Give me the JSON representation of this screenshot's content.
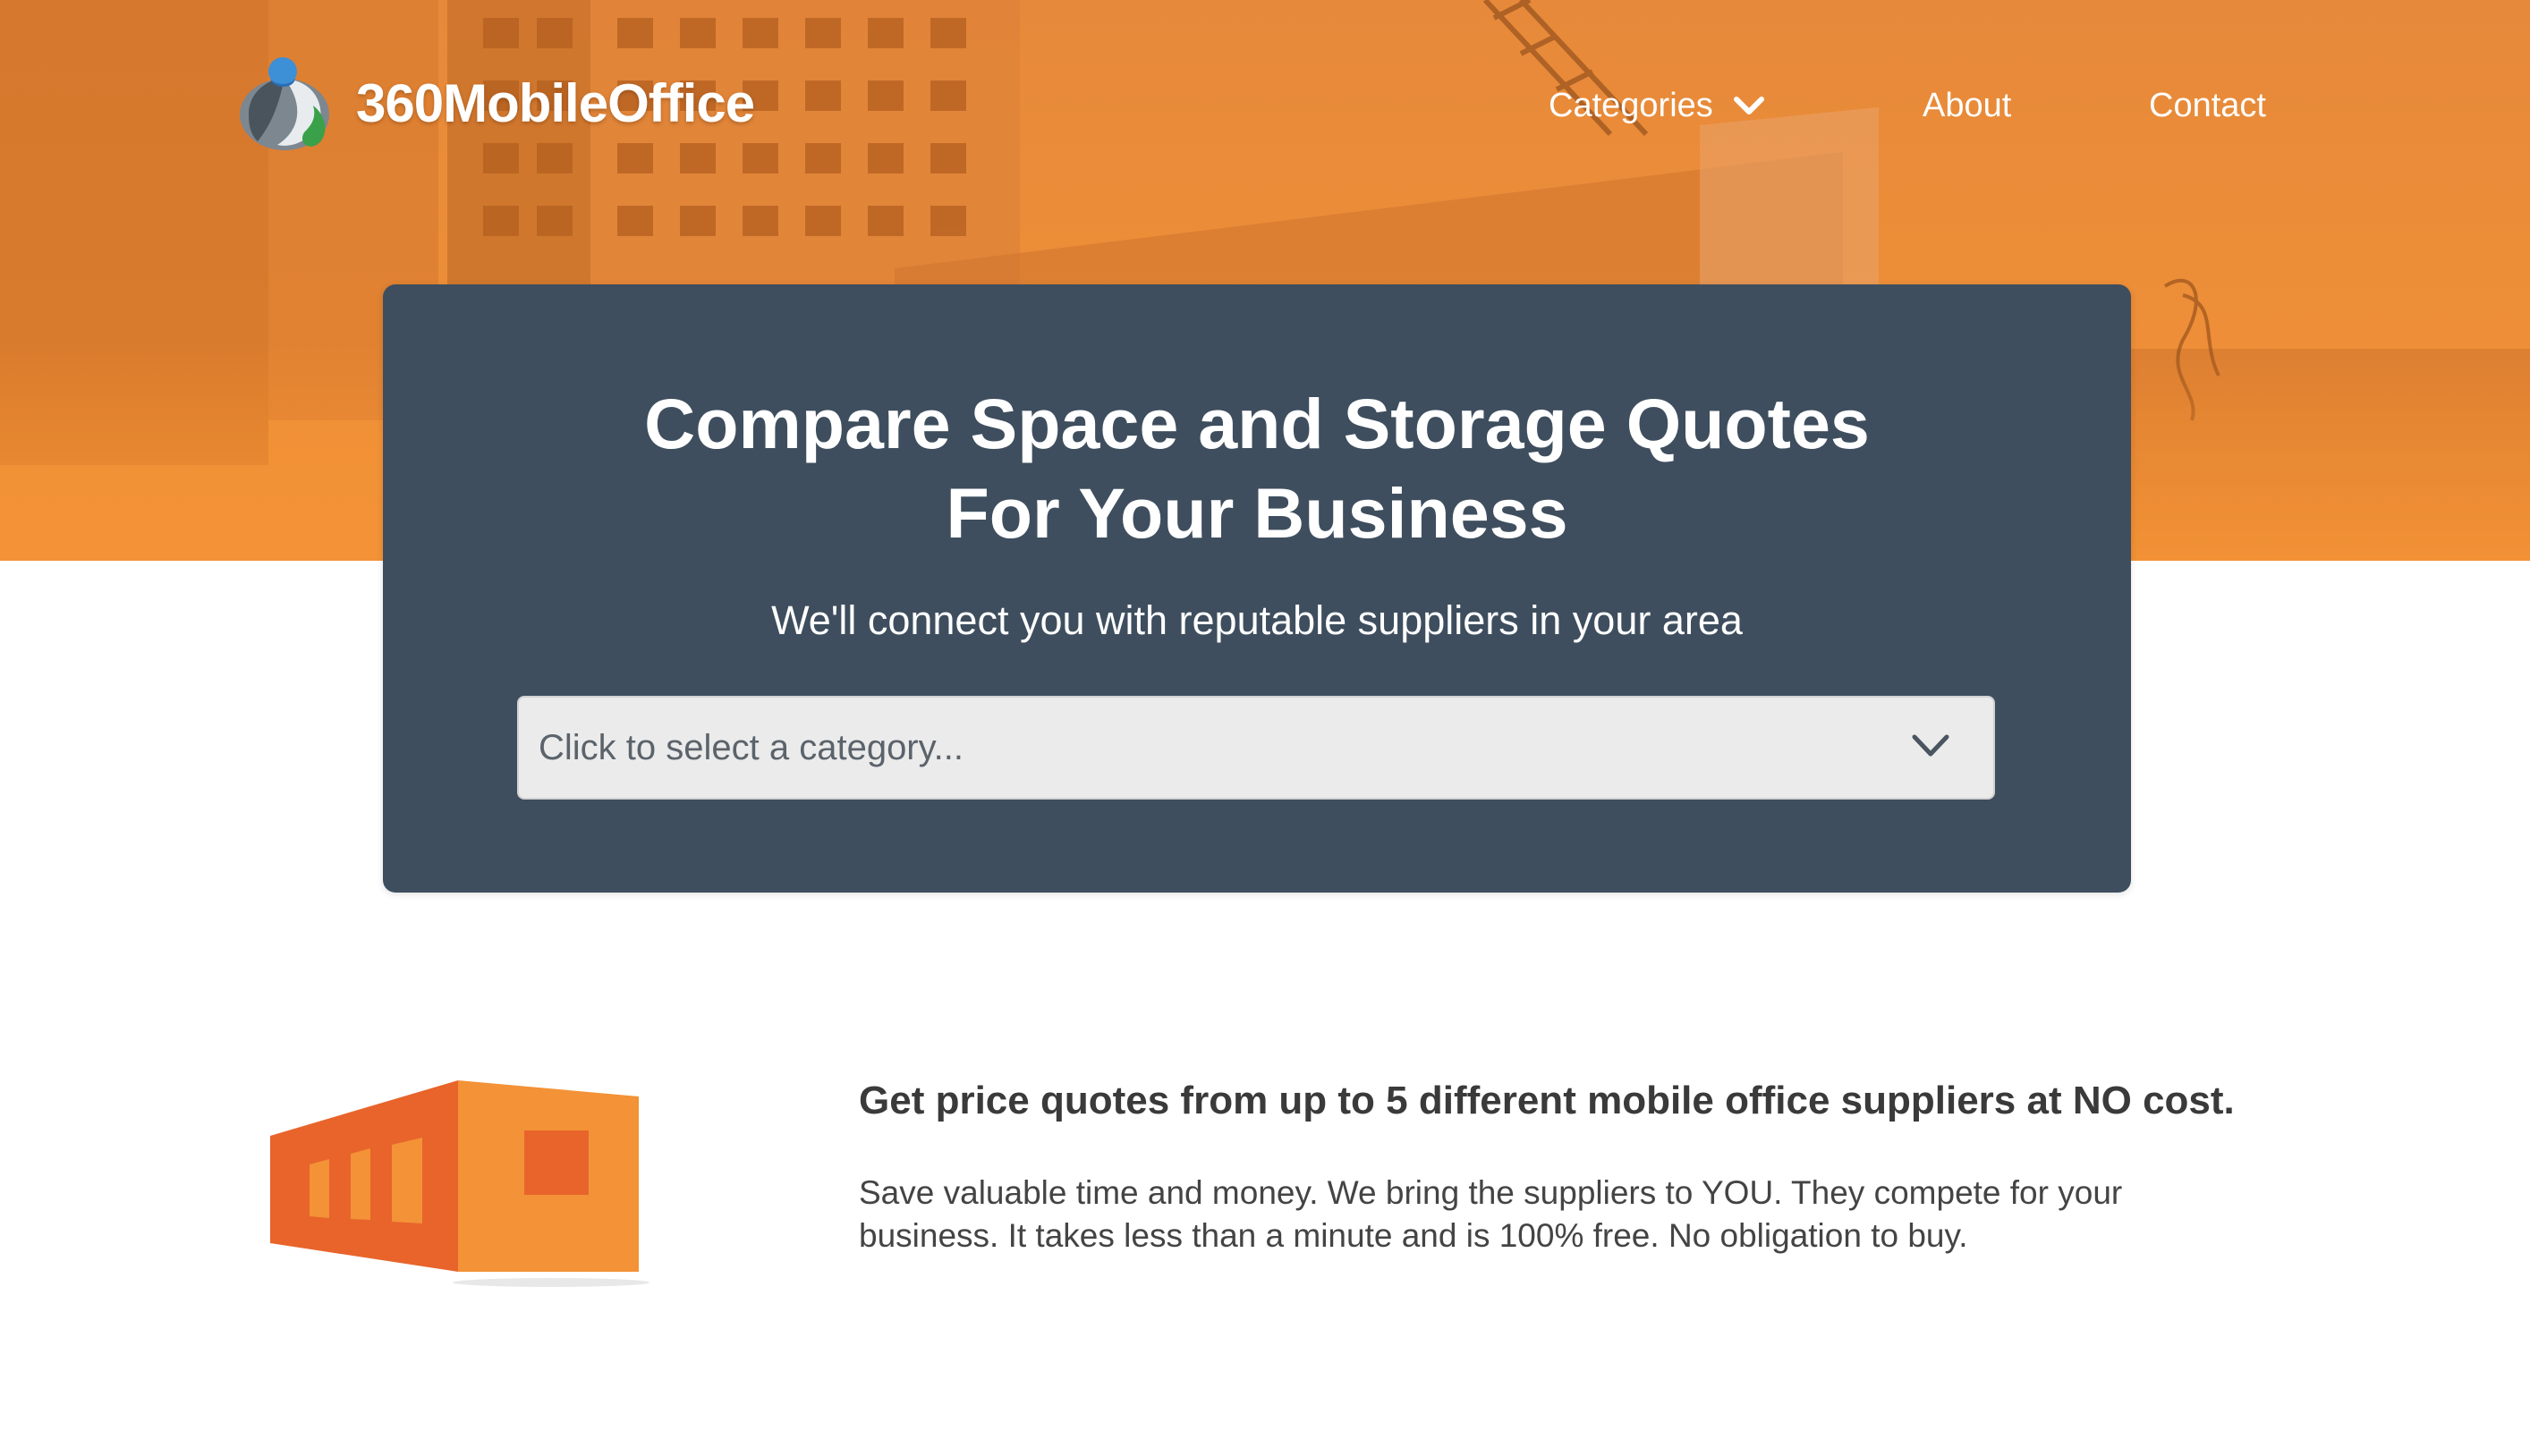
{
  "brand": {
    "logo_text": "360MobileOffice",
    "accent_color": "#f08d32",
    "card_color": "#3e4e5e"
  },
  "nav": {
    "items": [
      {
        "label": "Categories",
        "has_dropdown": true,
        "icon": "chevron-down-icon"
      },
      {
        "label": "About",
        "has_dropdown": false
      },
      {
        "label": "Contact",
        "has_dropdown": false
      }
    ]
  },
  "hero": {
    "title_line1": "Compare Space and Storage Quotes",
    "title_line2": "For Your Business",
    "subtitle": "We'll connect you with reputable suppliers in your area",
    "category_select": {
      "placeholder": "Click to select a category...",
      "icon": "chevron-down-icon"
    }
  },
  "feature": {
    "illustration": "mobile-office-container-icon",
    "heading": "Get price quotes from up to 5 different mobile office suppliers at NO cost.",
    "body": "Save valuable time and money. We bring the suppliers to YOU. They compete for your business. It takes less than a minute and is 100% free. No obligation to buy."
  }
}
